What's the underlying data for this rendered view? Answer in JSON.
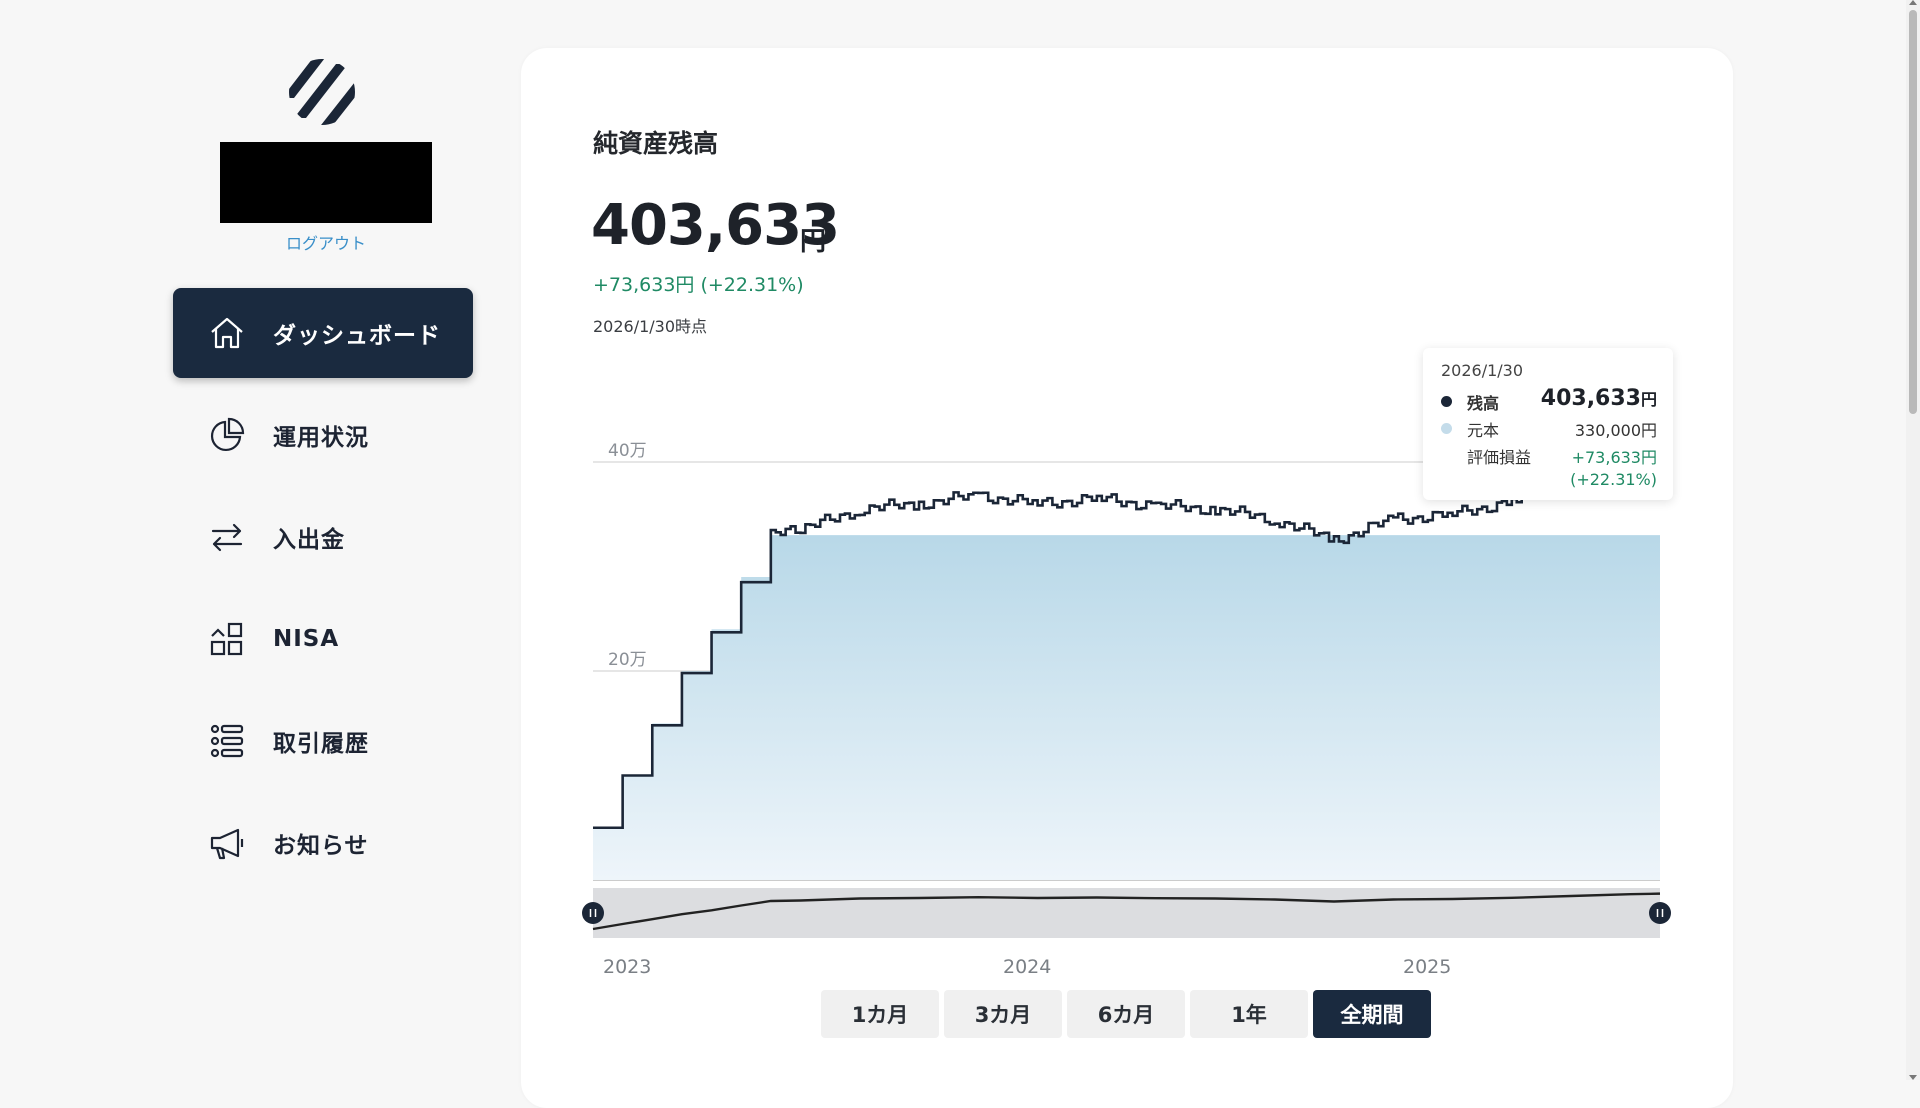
{
  "sidebar": {
    "logout_label": "ログアウト",
    "items": [
      {
        "label": "ダッシュボード",
        "icon": "home-icon",
        "active": true
      },
      {
        "label": "運用状況",
        "icon": "pie-chart-icon",
        "active": false
      },
      {
        "label": "入出金",
        "icon": "transfer-arrows-icon",
        "active": false
      },
      {
        "label": "NISA",
        "icon": "blocks-icon",
        "active": false
      },
      {
        "label": "取引履歴",
        "icon": "list-icon",
        "active": false
      },
      {
        "label": "お知らせ",
        "icon": "megaphone-icon",
        "active": false
      }
    ]
  },
  "main": {
    "title": "純資産残高",
    "value": "403,633",
    "unit": "円",
    "change": "+73,633円 (+22.31%)",
    "as_of": "2026/1/30時点"
  },
  "tooltip": {
    "date": "2026/1/30",
    "balance_label": "残高",
    "balance_value": "403,633",
    "balance_unit": "円",
    "principal_label": "元本",
    "principal_value": "330,000円",
    "pnl_label": "評価損益",
    "pnl_value": "+73,633円",
    "pnl_pct": "(+22.31%)"
  },
  "ranges": {
    "buttons": [
      "1カ月",
      "3カ月",
      "6カ月",
      "1年",
      "全期間"
    ],
    "selected": "全期間"
  },
  "colors": {
    "accent": "#1a2a3f",
    "positive": "#1f8a64",
    "principal_fill": "#b8d8e8",
    "balance_line": "#1b2637"
  },
  "chart_data": {
    "type": "area",
    "y_ticks": [
      "0",
      "20万",
      "40万"
    ],
    "ylim": [
      0,
      400000
    ],
    "x_tick_labels": [
      "2023",
      "2024",
      "2025"
    ],
    "x_range": [
      "2023-01",
      "2026-01"
    ],
    "series": [
      {
        "name": "元本",
        "x": [
          "2023-01",
          "2023-02",
          "2023-03",
          "2023-04",
          "2023-05",
          "2023-06",
          "2023-07",
          "2023-08",
          "2026-01"
        ],
        "values": [
          50000,
          100000,
          150000,
          200000,
          240000,
          290000,
          330000,
          330000,
          330000
        ]
      },
      {
        "name": "残高",
        "x": [
          "2023-01",
          "2023-02",
          "2023-03",
          "2023-04",
          "2023-05",
          "2023-06",
          "2023-07",
          "2023-08",
          "2023-10",
          "2023-12",
          "2024-02",
          "2024-04",
          "2024-06",
          "2024-08",
          "2024-10",
          "2024-12",
          "2025-02",
          "2025-04",
          "2025-06",
          "2025-08",
          "2025-10",
          "2025-12",
          "2026-01"
        ],
        "values": [
          50000,
          100000,
          148000,
          198000,
          237000,
          285000,
          330000,
          335000,
          355000,
          360000,
          368000,
          360000,
          365000,
          358000,
          355000,
          345000,
          325000,
          345000,
          350000,
          362000,
          380000,
          398000,
          403633
        ]
      }
    ],
    "grid": true,
    "legend": "tooltip"
  }
}
